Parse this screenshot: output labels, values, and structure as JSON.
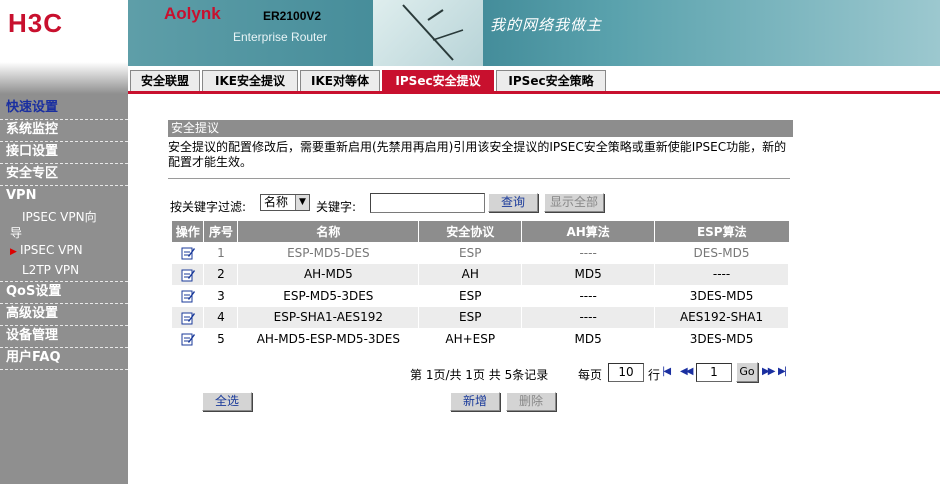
{
  "logo": "H3C",
  "banner": {
    "brand": "Aolynk",
    "model": "ER2100V2",
    "subtitle": "Enterprise Router",
    "slogan": "我的网络我做主"
  },
  "menu": {
    "quick": "快速设置",
    "monitor": "系统监控",
    "interface": "接口设置",
    "security": "安全专区",
    "vpn": "VPN",
    "vpn_sub_wizard": "IPSEC VPN向导",
    "vpn_sub_ipsec": "IPSEC VPN",
    "vpn_sub_l2tp": "L2TP VPN",
    "qos": "QoS设置",
    "advanced": "高级设置",
    "device": "设备管理",
    "faq": "用户FAQ"
  },
  "tabs": [
    "安全联盟",
    "IKE安全提议",
    "IKE对等体",
    "IPSec安全提议",
    "IPSec安全策略"
  ],
  "section": {
    "title": "安全提议",
    "desc": "安全提议的配置修改后，需要重新启用(先禁用再启用)引用该安全提议的IPSEC安全策略或重新使能IPSEC功能，新的配置才能生效。"
  },
  "filter": {
    "label": "按关键字过滤:",
    "select_value": "名称",
    "keyword_label": "关键字:",
    "keyword_value": "",
    "search_btn": "查询",
    "show_all_btn": "显示全部"
  },
  "table": {
    "headers": [
      "操作",
      "序号",
      "名称",
      "安全协议",
      "AH算法",
      "ESP算法"
    ],
    "rows": [
      [
        "1",
        "ESP-MD5-DES",
        "ESP",
        "----",
        "DES-MD5"
      ],
      [
        "2",
        "AH-MD5",
        "AH",
        "MD5",
        "----"
      ],
      [
        "3",
        "ESP-MD5-3DES",
        "ESP",
        "----",
        "3DES-MD5"
      ],
      [
        "4",
        "ESP-SHA1-AES192",
        "ESP",
        "----",
        "AES192-SHA1"
      ],
      [
        "5",
        "AH-MD5-ESP-MD5-3DES",
        "AH+ESP",
        "MD5",
        "3DES-MD5"
      ]
    ]
  },
  "pager": {
    "summary": "第 1页/共 1页 共 5条记录",
    "per_page_label": "每页",
    "per_page_value": "10",
    "rows_label": "行",
    "page_value": "1",
    "go": "Go"
  },
  "buttons": {
    "select_all": "全选",
    "add": "新增",
    "delete": "删除"
  },
  "colors": {
    "accent": "#c8102e",
    "sidebar": "#8f8f8f",
    "header_gray": "#8d8d8d"
  }
}
